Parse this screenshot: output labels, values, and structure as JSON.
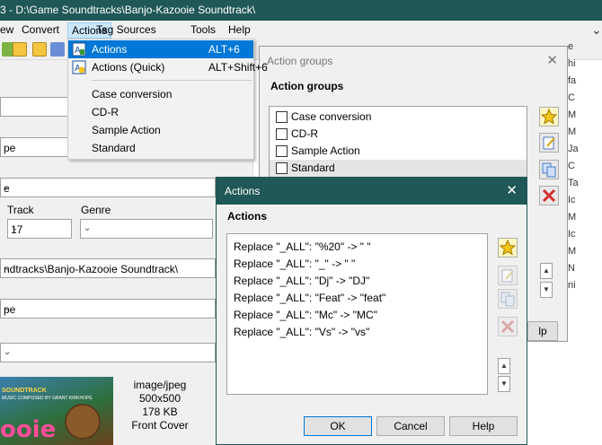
{
  "window": {
    "title": "3  -  D:\\Game Soundtracks\\Banjo-Kazooie Soundtrack\\"
  },
  "menubar": {
    "items": [
      {
        "label": "ew"
      },
      {
        "label": "Convert"
      },
      {
        "label": "Actions"
      },
      {
        "label": "Tag Sources"
      },
      {
        "label": "Tools"
      },
      {
        "label": "Help"
      }
    ]
  },
  "actions_menu": {
    "items": [
      {
        "label": "Actions",
        "shortcut": "ALT+6"
      },
      {
        "label": "Actions (Quick)",
        "shortcut": "ALT+Shift+6"
      },
      {
        "label": "Case conversion"
      },
      {
        "label": "CD-R"
      },
      {
        "label": "Sample Action"
      },
      {
        "label": "Standard"
      }
    ]
  },
  "left_panel": {
    "field_pe": "pe",
    "field_e": "e",
    "track_label": "Track",
    "track_value": "17",
    "genre_label": "Genre",
    "path_value": "ndtracks\\Banjo-Kazooie Soundtrack\\",
    "field_pe2": "pe",
    "cover": {
      "text_top": "SOUNDTRACK",
      "text_credit": "MUSIC COMPOSED BY GRANT KIRKHOPE",
      "logo": "ooie"
    },
    "image_info": {
      "mime": "image/jpeg",
      "dimensions": "500x500",
      "size": "178 KB",
      "type": "Front Cover"
    }
  },
  "right_list": {
    "rows": [
      "e",
      "hi",
      "fa",
      "C",
      "M",
      "M",
      "Ja",
      "C",
      "Ta",
      "Ic",
      "M",
      "Ic",
      "M",
      "N",
      "ni"
    ]
  },
  "action_groups_window": {
    "title": "Action groups",
    "section": "Action groups",
    "items": [
      "Case conversion",
      "CD-R",
      "Sample Action",
      "Standard"
    ],
    "partial_button": "lp"
  },
  "actions_window": {
    "title": "Actions",
    "section": "Actions",
    "items": [
      "Replace \"_ALL\": \"%20\" -> \" \"",
      "Replace \"_ALL\": \"_\" -> \" \"",
      "Replace \"_ALL\": \"Dj\" -> \"DJ\"",
      "Replace \"_ALL\": \"Feat\" -> \"feat\"",
      "Replace \"_ALL\": \"Mc\" -> \"MC\"",
      "Replace \"_ALL\": \"Vs\" -> \"vs\""
    ],
    "ok_label": "OK",
    "cancel_label": "Cancel",
    "help_label": "Help"
  },
  "colors": {
    "titlebar": "#1f5856",
    "menu_highlight": "#0078d7",
    "delete_red": "#d32f2f"
  }
}
